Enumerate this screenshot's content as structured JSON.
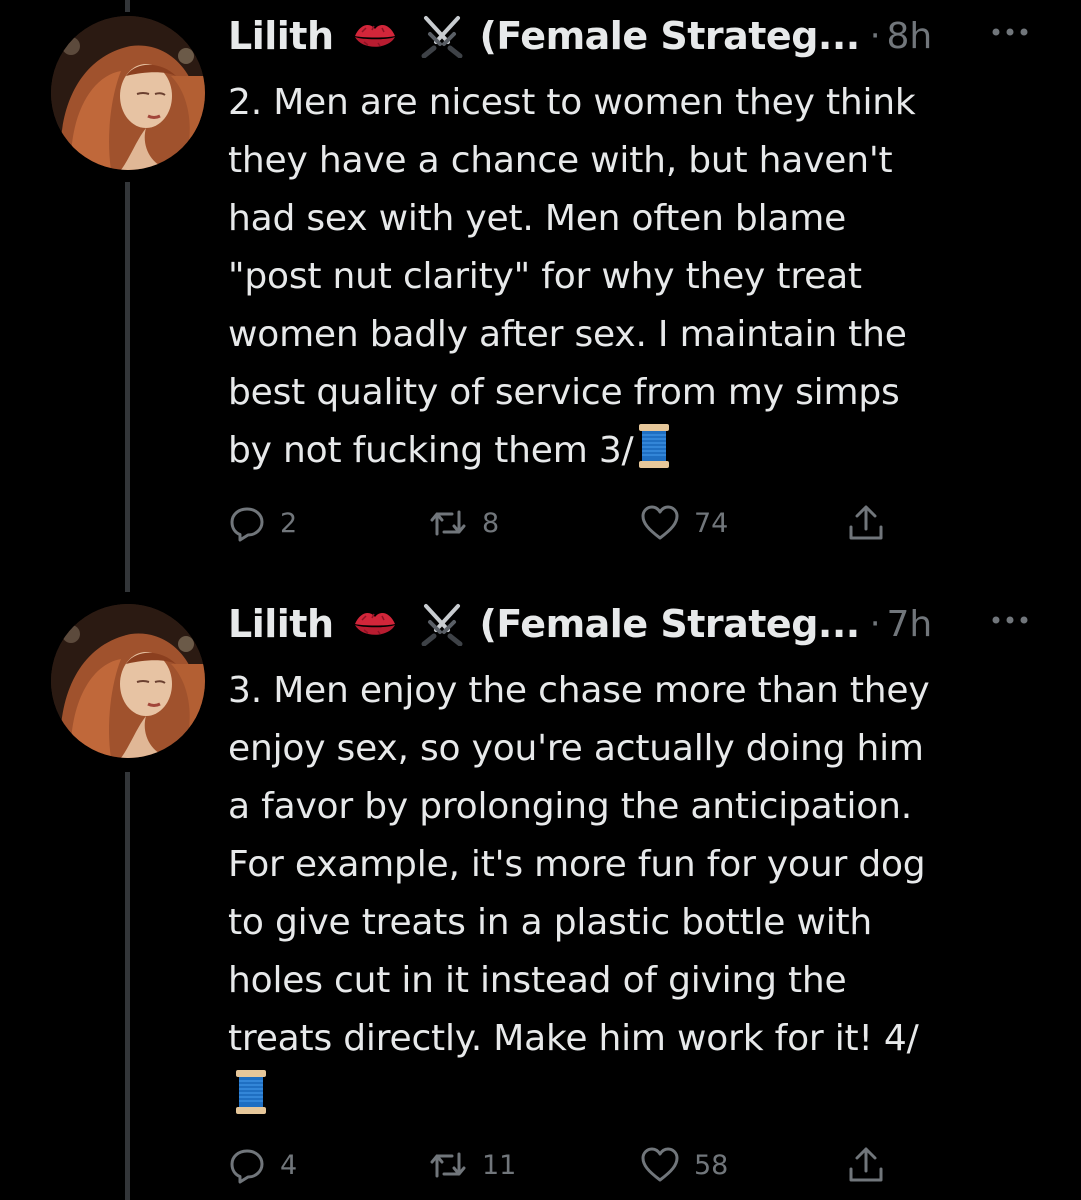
{
  "tweets": [
    {
      "name": "Lilith",
      "display_suffix": "(Female Strateg...",
      "dot": "·",
      "time": "8h",
      "lines": [
        "2. Men are nicest to women they think",
        "they have a chance with, but haven't",
        "had sex with yet. Men often blame",
        "\"post nut clarity\" for why they treat",
        "women badly after sex. I maintain the",
        "best quality of service from my simps",
        "by not fucking them 3/"
      ],
      "trailing_emoji": "spool-of-thread-emoji",
      "replies": "2",
      "retweets": "8",
      "likes": "74"
    },
    {
      "name": "Lilith",
      "display_suffix": "(Female Strateg...",
      "dot": "·",
      "time": "7h",
      "lines": [
        "3. Men enjoy the chase more than they",
        "enjoy sex, so you're actually doing him",
        "a favor by prolonging the anticipation.",
        "For example, it's more fun for your dog",
        "to give treats in a plastic bottle with",
        "holes cut in it instead of giving the",
        "treats directly. Make him work for it! 4/"
      ],
      "trailing_emoji": "spool-of-thread-emoji",
      "replies": "4",
      "retweets": "11",
      "likes": "58"
    }
  ],
  "icons": {
    "name_emoji_1": "kiss-mark-icon",
    "name_emoji_2": "crossed-swords-icon",
    "more": "more-options-icon",
    "reply": "reply-icon",
    "retweet": "retweet-icon",
    "like": "heart-icon",
    "share": "share-icon"
  },
  "colors": {
    "background": "#000000",
    "text": "#e7e9ea",
    "secondary": "#71767b",
    "thread_line": "#333639"
  }
}
